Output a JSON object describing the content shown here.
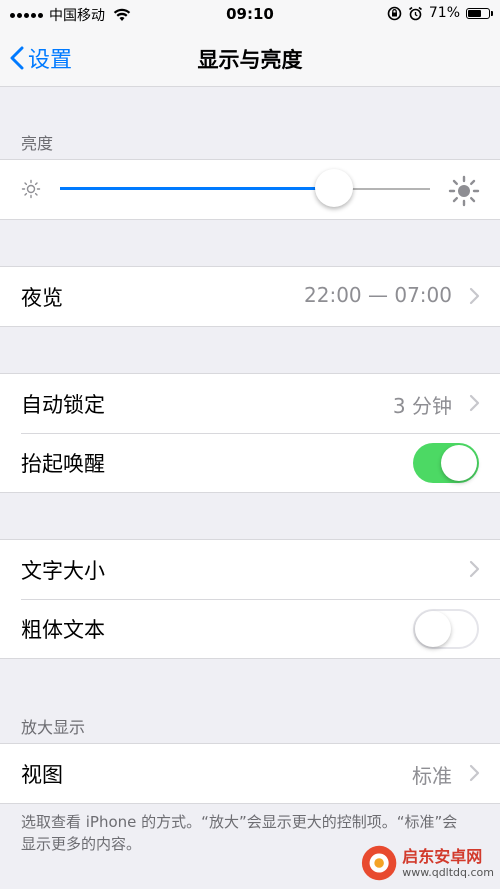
{
  "status_bar": {
    "carrier": "中国移动",
    "time": "09:10",
    "battery_percent": "71%",
    "battery_level": 0.71
  },
  "nav": {
    "back_label": "设置",
    "title": "显示与亮度"
  },
  "brightness": {
    "header": "亮度",
    "level": 0.74
  },
  "night_shift": {
    "label": "夜览",
    "value": "22:00 — 07:00"
  },
  "auto_lock": {
    "label": "自动锁定",
    "value": "3 分钟"
  },
  "raise_to_wake": {
    "label": "抬起唤醒",
    "on": true
  },
  "text_size": {
    "label": "文字大小"
  },
  "bold_text": {
    "label": "粗体文本",
    "on": false
  },
  "zoom": {
    "header": "放大显示",
    "view_label": "视图",
    "view_value": "标准",
    "footnote": "选取查看 iPhone 的方式。“放大”会显示更大的控制项。“标准”会显示更多的内容。"
  },
  "watermark": {
    "title": "启东安卓网",
    "url": "www.qdltdq.com"
  },
  "colors": {
    "accent": "#007aff",
    "toggle_on": "#4cd964",
    "background": "#efeff4"
  }
}
